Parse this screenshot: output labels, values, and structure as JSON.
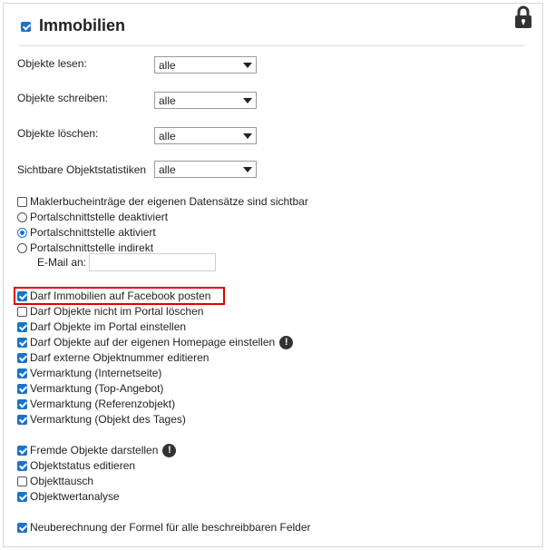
{
  "header": {
    "title": "Immobilien",
    "checked": true,
    "lock_icon": "lock-icon"
  },
  "selects": [
    {
      "label": "Objekte lesen:",
      "value": "alle"
    },
    {
      "label": "Objekte schreiben:",
      "value": "alle"
    },
    {
      "label": "Objekte löschen:",
      "value": "alle"
    },
    {
      "label": "Sichtbare Objektstatistiken",
      "value": "alle"
    }
  ],
  "options_block": {
    "makler_checkbox": {
      "label": "Maklerbucheinträge der eigenen Datensätze sind sichtbar",
      "checked": false
    },
    "radios": [
      {
        "label": "Portalschnittstelle deaktiviert",
        "selected": false
      },
      {
        "label": "Portalschnittstelle aktiviert",
        "selected": true
      },
      {
        "label": "Portalschnittstelle indirekt",
        "selected": false
      }
    ],
    "email_label": "E-Mail an:",
    "email_value": ""
  },
  "permissions_1": [
    {
      "label": "Darf Immobilien auf Facebook posten",
      "checked": true
    },
    {
      "label": "Darf Objekte nicht im Portal löschen",
      "checked": false
    },
    {
      "label": "Darf Objekte im Portal einstellen",
      "checked": true
    },
    {
      "label": "Darf Objekte auf der eigenen Homepage einstellen",
      "checked": true
    },
    {
      "label": "Darf externe Objektnummer editieren",
      "checked": true
    },
    {
      "label": "Vermarktung (Internetseite)",
      "checked": true
    },
    {
      "label": "Vermarktung (Top-Angebot)",
      "checked": true
    },
    {
      "label": "Vermarktung (Referenzobjekt)",
      "checked": true
    },
    {
      "label": "Vermarktung (Objekt des Tages)",
      "checked": true
    }
  ],
  "permissions_2": [
    {
      "label": "Fremde Objekte darstellen",
      "checked": true
    },
    {
      "label": "Objektstatus editieren",
      "checked": true
    },
    {
      "label": "Objekttausch",
      "checked": false
    },
    {
      "label": "Objektwertanalyse",
      "checked": true
    }
  ],
  "permissions_3": [
    {
      "label": "Neuberechnung der Formel für alle beschreibbaren Felder",
      "checked": true
    }
  ],
  "info_glyph": "!",
  "accent_color": "#1a73c9",
  "highlight_color": "#e00000"
}
